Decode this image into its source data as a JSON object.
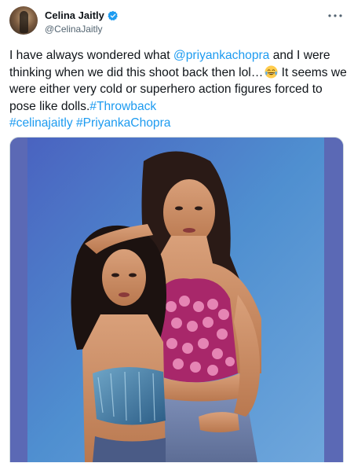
{
  "author": {
    "name": "Celina Jaitly",
    "handle": "@CelinaJaitly",
    "verified": true,
    "avatar_icon": "profile-photo"
  },
  "tweet": {
    "line1_a": "I have always wondered what ",
    "mention": "@priyankachopra",
    "line1_b": " and I were thinking when we did this shoot back then lol…",
    "emoji": "face-with-tears-of-joy",
    "line2": " It seems we were either very cold or superhero action figures forced to pose like dolls.",
    "hashtag1": "#Throwback",
    "hashtag2": "#celinajaitly",
    "hashtag3": "#PriyankaChopra"
  },
  "media": {
    "type": "photo",
    "description_icon": "photo-two-women-posing"
  },
  "colors": {
    "link": "#1d9bf0",
    "text": "#0f1419",
    "secondary": "#536471",
    "verified": "#1d9bf0",
    "photo_backdrop": "#5b69b5"
  }
}
